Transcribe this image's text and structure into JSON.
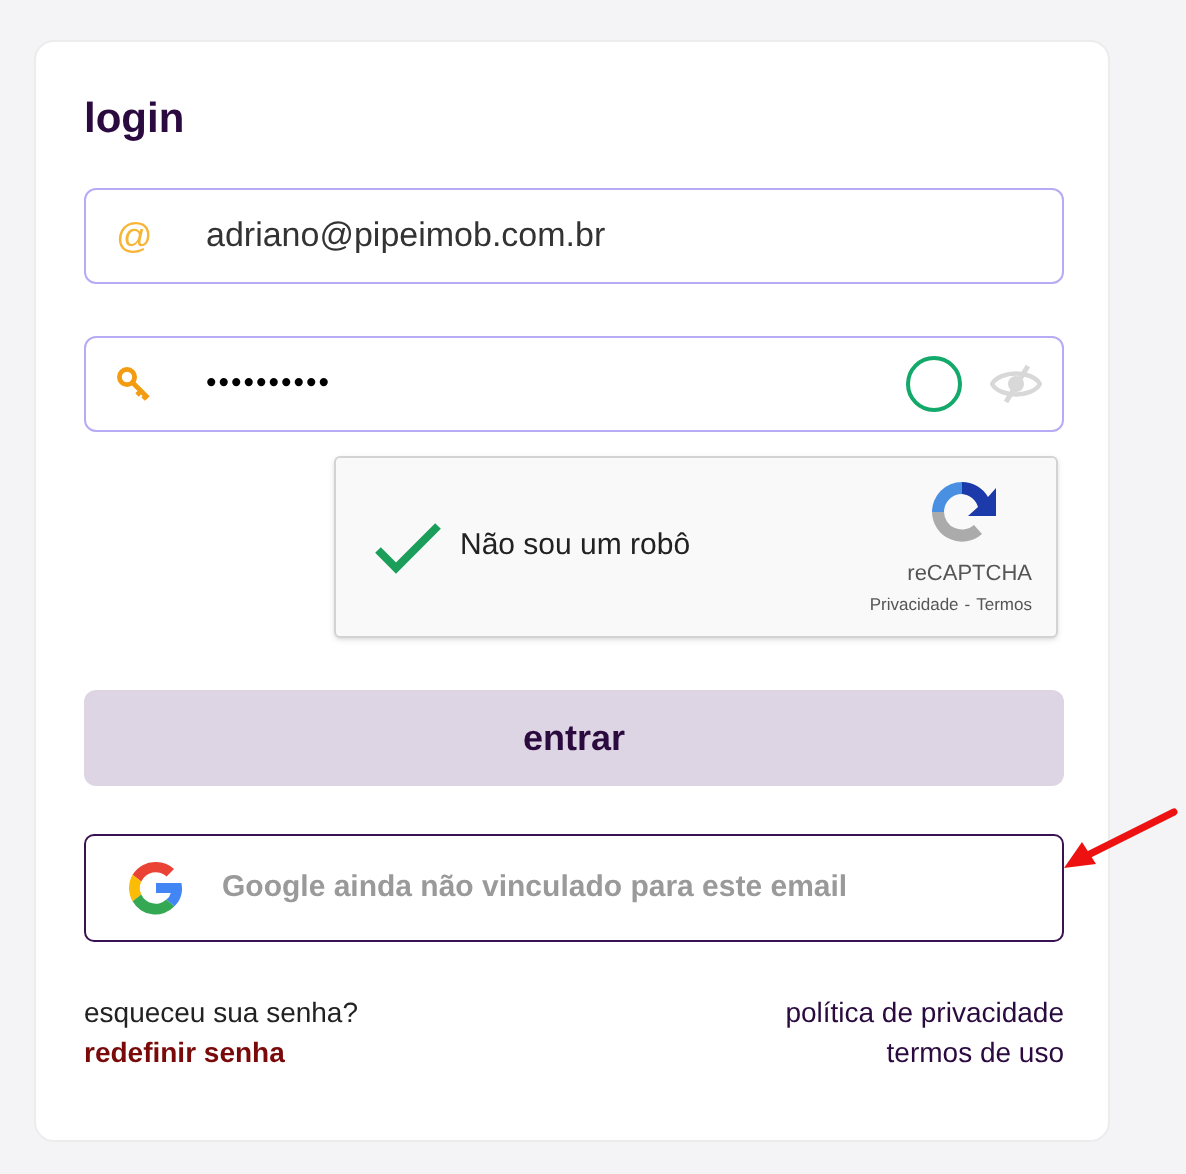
{
  "title": "login",
  "email_field": {
    "icon": "@",
    "value": "adriano@pipeimob.com.br"
  },
  "password_field": {
    "value": "••••••••••",
    "visible": false
  },
  "captcha": {
    "label": "Não sou um robô",
    "checked": true,
    "brand": "reCAPTCHA",
    "links": [
      "Privacidade",
      "Termos"
    ],
    "separator": "-"
  },
  "submit_button": {
    "label": "entrar",
    "disabled": true
  },
  "google_button": {
    "label": "Google ainda não vinculado para este email"
  },
  "forgot": {
    "question": "esqueceu sua senha?",
    "link": "redefinir senha"
  },
  "footer_links": [
    "política de privacidade",
    "termos de uso"
  ]
}
